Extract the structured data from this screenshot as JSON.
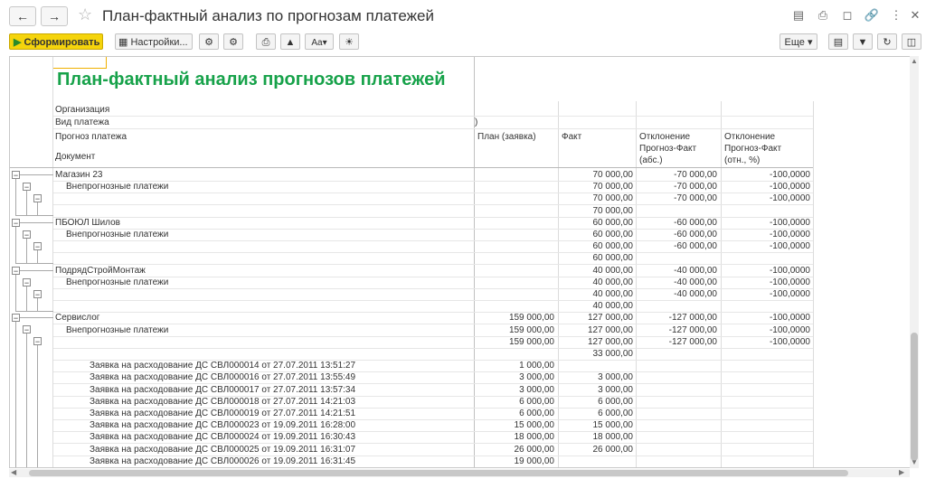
{
  "window": {
    "title": "План-фактный анализ по прогнозам платежей"
  },
  "toolbar": {
    "generate_label": "Сформировать",
    "settings_label": "Настройки...",
    "more_label": "Еще"
  },
  "report": {
    "title": "План-фактный анализ прогнозов платежей",
    "filter_org": "Организация",
    "filter_type": "Вид платежа",
    "filter_type_value": ")",
    "header": {
      "col1_a": "Прогноз платежа",
      "col1_b": "Документ",
      "plan": "План (заявка)",
      "fact": "Факт",
      "abs_1": "Отклонение",
      "abs_2": "Прогноз-Факт",
      "abs_3": "(абс.)",
      "rel_1": "Отклонение",
      "rel_2": "Прогноз-Факт",
      "rel_3": "(отн., %)"
    },
    "rows": [
      [
        "Магазин 23",
        "",
        "70 000,00",
        "-70 000,00",
        "-100,0000"
      ],
      [
        "Внепрогнозные платежи",
        "",
        "70 000,00",
        "-70 000,00",
        "-100,0000"
      ],
      [
        "",
        "",
        "70 000,00",
        "-70 000,00",
        "-100,0000"
      ],
      [
        "",
        "",
        "70 000,00",
        "",
        ""
      ],
      [
        "ПБОЮЛ  Шилов",
        "",
        "60 000,00",
        "-60 000,00",
        "-100,0000"
      ],
      [
        "Внепрогнозные платежи",
        "",
        "60 000,00",
        "-60 000,00",
        "-100,0000"
      ],
      [
        "",
        "",
        "60 000,00",
        "-60 000,00",
        "-100,0000"
      ],
      [
        "",
        "",
        "60 000,00",
        "",
        ""
      ],
      [
        "ПодрядСтройМонтаж",
        "",
        "40 000,00",
        "-40 000,00",
        "-100,0000"
      ],
      [
        "Внепрогнозные платежи",
        "",
        "40 000,00",
        "-40 000,00",
        "-100,0000"
      ],
      [
        "",
        "",
        "40 000,00",
        "-40 000,00",
        "-100,0000"
      ],
      [
        "",
        "",
        "40 000,00",
        "",
        ""
      ],
      [
        "Сервислог",
        "159 000,00",
        "127 000,00",
        "-127 000,00",
        "-100,0000"
      ],
      [
        "Внепрогнозные платежи",
        "159 000,00",
        "127 000,00",
        "-127 000,00",
        "-100,0000"
      ],
      [
        "",
        "159 000,00",
        "127 000,00",
        "-127 000,00",
        "-100,0000"
      ],
      [
        "",
        "",
        "33 000,00",
        "",
        ""
      ],
      [
        "Заявка на расходование ДС СВЛ000014 от 27.07.2011 13:51:27",
        "1 000,00",
        "",
        "",
        ""
      ],
      [
        "Заявка на расходование ДС СВЛ000016 от 27.07.2011 13:55:49",
        "3 000,00",
        "3 000,00",
        "",
        ""
      ],
      [
        "Заявка на расходование ДС СВЛ000017 от 27.07.2011 13:57:34",
        "3 000,00",
        "3 000,00",
        "",
        ""
      ],
      [
        "Заявка на расходование ДС СВЛ000018 от 27.07.2011 14:21:03",
        "6 000,00",
        "6 000,00",
        "",
        ""
      ],
      [
        "Заявка на расходование ДС СВЛ000019 от 27.07.2011 14:21:51",
        "6 000,00",
        "6 000,00",
        "",
        ""
      ],
      [
        "Заявка на расходование ДС СВЛ000023 от 19.09.2011 16:28:00",
        "15 000,00",
        "15 000,00",
        "",
        ""
      ],
      [
        "Заявка на расходование ДС СВЛ000024 от 19.09.2011 16:30:43",
        "18 000,00",
        "18 000,00",
        "",
        ""
      ],
      [
        "Заявка на расходование ДС СВЛ000025 от 19.09.2011 16:31:07",
        "26 000,00",
        "26 000,00",
        "",
        ""
      ],
      [
        "Заявка на расходование ДС СВЛ000026 от 19.09.2011 16:31:45",
        "19 000,00",
        "",
        "",
        ""
      ]
    ]
  }
}
